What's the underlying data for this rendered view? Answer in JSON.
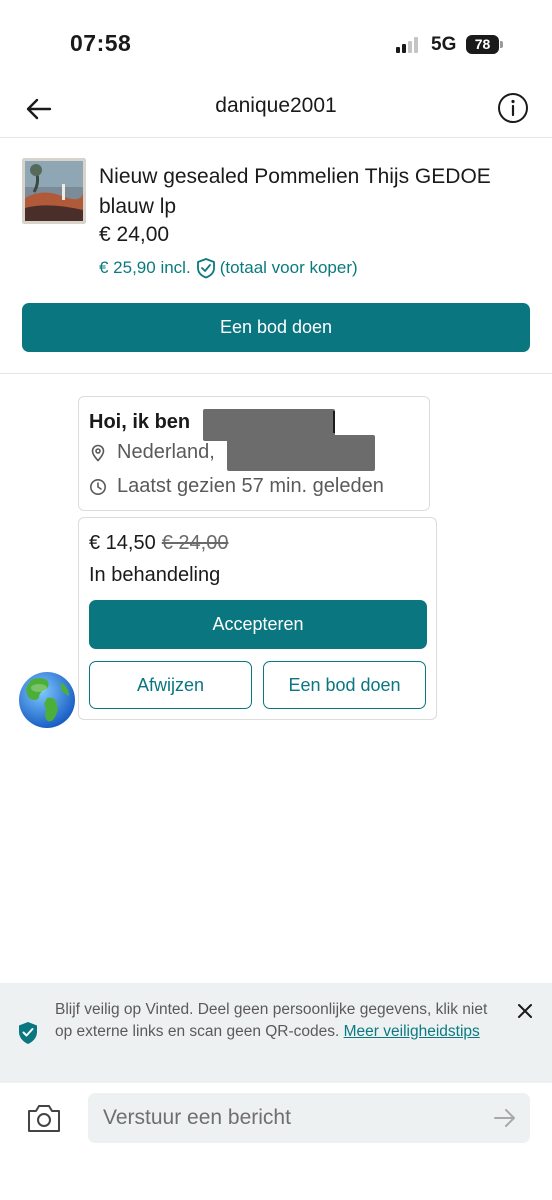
{
  "status_bar": {
    "time": "07:58",
    "network": "5G",
    "battery": "78"
  },
  "header": {
    "title": "danique2001"
  },
  "item": {
    "title": "Nieuw gesealed Pommelien Thijs GEDOE blauw lp",
    "price": "€ 24,00",
    "price_incl": "€ 25,90 incl.",
    "buyer_total_note": "(totaal voor koper)",
    "offer_button": "Een bod doen"
  },
  "intro_card": {
    "greeting": "Hoi, ik ben",
    "location": "Nederland,",
    "last_seen": "Laatst gezien 57 min. geleden"
  },
  "offer_card": {
    "offer_price": "€ 14,50",
    "original_price": "€ 24,00",
    "status": "In behandeling",
    "accept_label": "Accepteren",
    "decline_label": "Afwijzen",
    "counter_label": "Een bod doen"
  },
  "safety_banner": {
    "text": "Blijf veilig op Vinted. Deel geen persoonlijke gegevens, klik niet op externe links en scan geen QR-codes.",
    "link": "Meer veiligheidstips"
  },
  "composer": {
    "placeholder": "Verstuur een bericht"
  },
  "colors": {
    "accent": "#097680",
    "accent_text": "#0b7a80",
    "banner_bg": "#eef1f2"
  },
  "icons": [
    "back-arrow-icon",
    "info-icon",
    "shield-check-icon",
    "location-pin-icon",
    "clock-icon",
    "globe-avatar-icon",
    "close-icon",
    "camera-icon",
    "send-arrow-icon"
  ]
}
